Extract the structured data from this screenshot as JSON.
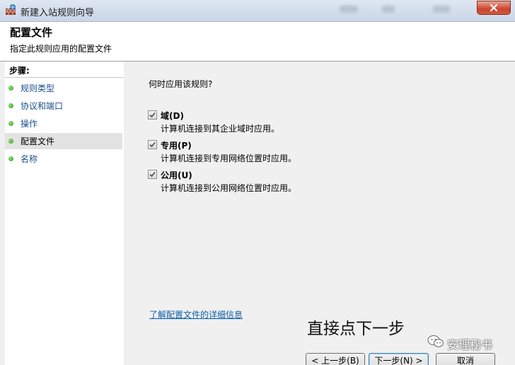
{
  "window": {
    "title": "新建入站规则向导",
    "icon": "firewall-wizard-icon"
  },
  "header": {
    "title": "配置文件",
    "subtitle": "指定此规则应用的配置文件"
  },
  "steps": {
    "title": "步骤:",
    "items": [
      {
        "label": "规则类型",
        "active": false
      },
      {
        "label": "协议和端口",
        "active": false
      },
      {
        "label": "操作",
        "active": false
      },
      {
        "label": "配置文件",
        "active": true
      },
      {
        "label": "名称",
        "active": false
      }
    ]
  },
  "main": {
    "question": "何时应用该规则?",
    "options": [
      {
        "label": "域(D)",
        "description": "计算机连接到其企业域时应用。",
        "checked": true
      },
      {
        "label": "专用(P)",
        "description": "计算机连接到专用网络位置时应用。",
        "checked": true
      },
      {
        "label": "公用(U)",
        "description": "计算机连接到公用网络位置时应用。",
        "checked": true
      }
    ],
    "learn_more": "了解配置文件的详细信息"
  },
  "annotation": "直接点下一步",
  "watermark": "安理秘书",
  "buttons": {
    "back": "< 上一步(B)",
    "next": "下一步(N) >",
    "cancel": "取消"
  },
  "colors": {
    "link": "#0b5ea8",
    "step_dot": "#2f9c1f",
    "close_button": "#c9442b"
  }
}
